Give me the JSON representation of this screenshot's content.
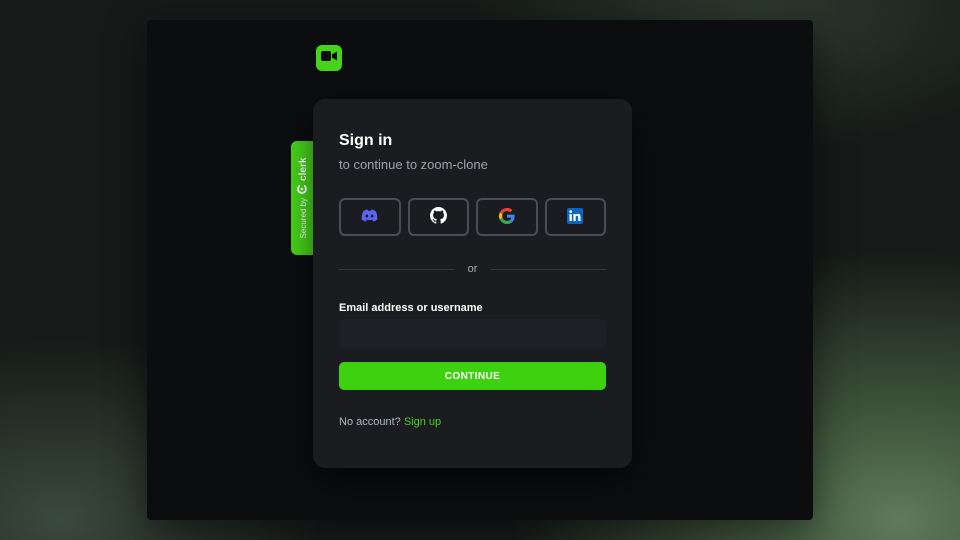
{
  "app": {
    "logo_icon": "video-camera-icon",
    "accent_color": "#46d41a"
  },
  "badge": {
    "secured_by": "Secured by",
    "clerk_label": "clerk",
    "clerk_icon": "clerk-logo-icon"
  },
  "card": {
    "title": "Sign in",
    "subtitle": "to continue to zoom-clone"
  },
  "social": [
    {
      "provider": "Discord",
      "icon": "discord-icon",
      "color": "#5865f2"
    },
    {
      "provider": "GitHub",
      "icon": "github-icon",
      "color": "#ffffff"
    },
    {
      "provider": "Google",
      "icon": "google-icon",
      "color": "#4285f4"
    },
    {
      "provider": "LinkedIn",
      "icon": "linkedin-icon",
      "color": "#0a66c2"
    }
  ],
  "divider": {
    "text": "or"
  },
  "form": {
    "email_label": "Email address or username",
    "email_value": "",
    "continue_label": "CONTINUE"
  },
  "footer": {
    "prompt": "No account?",
    "signup_label": "Sign up"
  }
}
